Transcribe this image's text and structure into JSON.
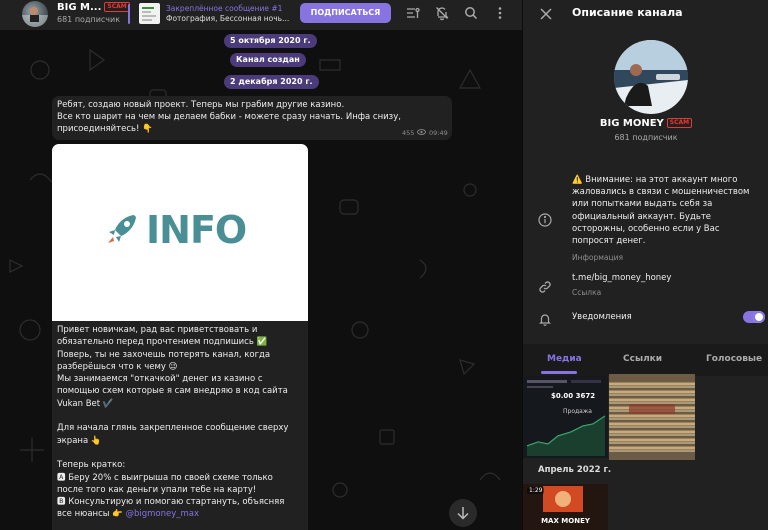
{
  "header": {
    "title": "BIG M...",
    "scam_badge": "SCAM",
    "subtitle": "681 подписчик",
    "pinned_title": "Закреплённое сообщение #1",
    "pinned_text": "Фотография, Бессонная ночь...",
    "subscribe_label": "ПОДПИСАТЬСЯ",
    "icons": [
      "video-chat-icon",
      "mute-icon",
      "search-icon",
      "more-icon"
    ]
  },
  "chat": {
    "dates": [
      "5 октября 2020 г.",
      "Канал создан",
      "2 декабря 2020 г."
    ],
    "message1": {
      "text": "Ребят, создаю новый проект. Теперь мы грабим другие казино.\nВсе кто шарит на чем мы делаем бабки - можете сразу начать. Инфа снизу, присоединяйтесь! 👇",
      "views": "455",
      "time": "09:49"
    },
    "post": {
      "image_caption": "INFO",
      "lines": [
        "Привет новичкам, рад вас приветствовать и",
        "обязательно перед прочтением подпишись ✅",
        "Поверь, ты не захочешь потерять канал, когда",
        "разберёшься что к чему 😉",
        "Мы занимаемся \"откачкой\" денег из казино с",
        "помощью схем которые я сам внедряю в код сайта",
        "Vukan Bet ✔️",
        "",
        "Для начала глянь закрепленное сообщение сверху",
        "экрана 👆",
        "",
        "Теперь кратко:",
        "🅰 Беру 20% с выигрыша по своей схеме только",
        "после того как деньги упали тебе на карту!",
        "🅱 Консультирую и помогаю стартануть, объясняя",
        "все нюансы 👉 @bigmoney_max"
      ]
    }
  },
  "panel": {
    "title": "Описание канала",
    "channel_name": "BIG MONEY",
    "scam_badge": "SCAM",
    "subscribers": "681 подписчик",
    "warning": "⚠️ Внимание: на этот аккаунт много жаловались в связи с мошенничеством или попытками выдать себя за официальный аккаунт. Будьте осторожны, особенно если у Вас попросят денег.",
    "warning_label": "Информация",
    "link": "t.me/big_money_honey",
    "link_label": "Ссылка",
    "notifications_label": "Уведомления",
    "notifications_on": true,
    "tabs": [
      "Медиа",
      "Ссылки",
      "Голосовые"
    ],
    "active_tab": "Медиа",
    "media_month": "Апрель 2022 г.",
    "thumb_texts": {
      "screenshot_title": "$0.00 3672",
      "screenshot_label": "Продажа",
      "video_duration": "1:29",
      "bottom_caption": "MAX MONEY"
    },
    "colors": {
      "accent": "#8774e1",
      "scam": "#e53935"
    }
  }
}
